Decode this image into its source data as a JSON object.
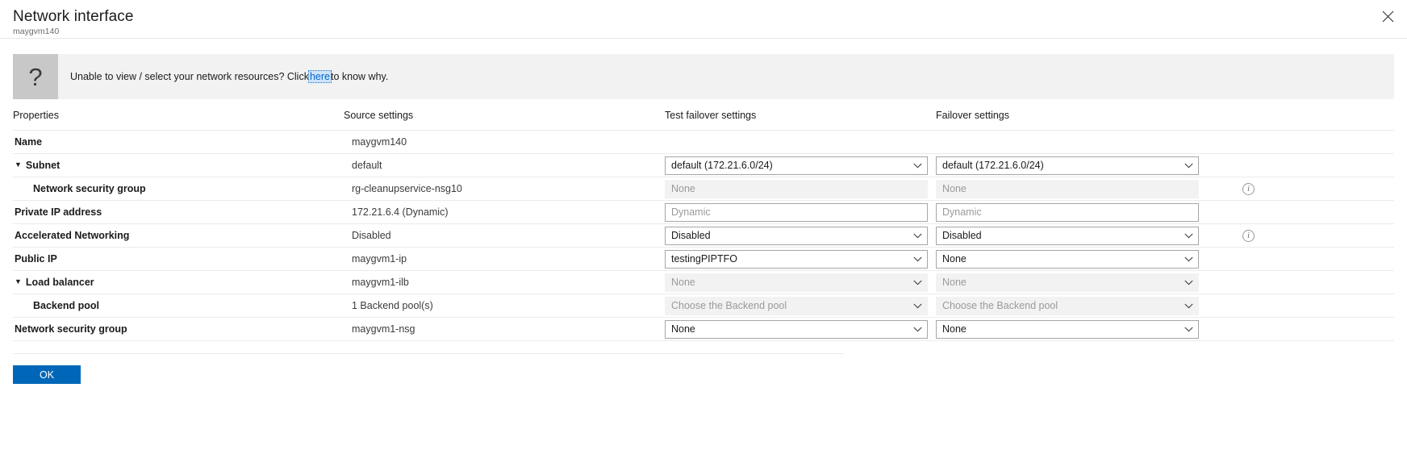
{
  "header": {
    "title": "Network interface",
    "subtitle": "maygvm140",
    "close_icon": "close-icon"
  },
  "banner": {
    "icon": "question-mark-icon",
    "icon_glyph": "?",
    "text_before": "Unable to view / select your network resources? Click ",
    "link_text": "here",
    "text_after": " to know why."
  },
  "table": {
    "headers": {
      "properties": "Properties",
      "source": "Source settings",
      "test_failover": "Test failover settings",
      "failover": "Failover settings"
    },
    "rows": [
      {
        "property": "Name",
        "expander": "",
        "indent": false,
        "source": "maygvm140",
        "tfo": {
          "type": "none"
        },
        "fo": {
          "type": "none"
        },
        "info": false
      },
      {
        "property": "Subnet",
        "expander": "▼",
        "indent": false,
        "source": "default",
        "tfo": {
          "type": "dropdown",
          "state": "enabled",
          "value": "default (172.21.6.0/24)"
        },
        "fo": {
          "type": "dropdown",
          "state": "enabled",
          "value": "default (172.21.6.0/24)"
        },
        "info": false
      },
      {
        "property": "Network security group",
        "expander": "",
        "indent": true,
        "source": "rg-cleanupservice-nsg10",
        "tfo": {
          "type": "plain",
          "state": "disabled",
          "value": "None"
        },
        "fo": {
          "type": "plain",
          "state": "disabled",
          "value": "None"
        },
        "info": true
      },
      {
        "property": "Private IP address",
        "expander": "",
        "indent": false,
        "source": "172.21.6.4 (Dynamic)",
        "tfo": {
          "type": "textbox",
          "state": "placeholder",
          "value": "Dynamic"
        },
        "fo": {
          "type": "textbox",
          "state": "placeholder",
          "value": "Dynamic"
        },
        "info": false
      },
      {
        "property": "Accelerated Networking",
        "expander": "",
        "indent": false,
        "source": "Disabled",
        "tfo": {
          "type": "dropdown",
          "state": "enabled",
          "value": "Disabled"
        },
        "fo": {
          "type": "dropdown",
          "state": "enabled",
          "value": "Disabled"
        },
        "info": true
      },
      {
        "property": "Public IP",
        "expander": "",
        "indent": false,
        "source": "maygvm1-ip",
        "tfo": {
          "type": "dropdown",
          "state": "enabled",
          "value": "testingPIPTFO"
        },
        "fo": {
          "type": "dropdown",
          "state": "enabled",
          "value": "None"
        },
        "info": false
      },
      {
        "property": "Load balancer",
        "expander": "▼",
        "indent": false,
        "source": "maygvm1-ilb",
        "tfo": {
          "type": "dropdown",
          "state": "disabled",
          "value": "None"
        },
        "fo": {
          "type": "dropdown",
          "state": "disabled",
          "value": "None"
        },
        "info": false
      },
      {
        "property": "Backend pool",
        "expander": "",
        "indent": true,
        "source": "1 Backend pool(s)",
        "tfo": {
          "type": "dropdown",
          "state": "disabled",
          "value": "Choose the Backend pool"
        },
        "fo": {
          "type": "dropdown",
          "state": "disabled",
          "value": "Choose the Backend pool"
        },
        "info": false
      },
      {
        "property": "Network security group",
        "expander": "",
        "indent": false,
        "source": "maygvm1-nsg",
        "tfo": {
          "type": "dropdown",
          "state": "enabled",
          "value": "None"
        },
        "fo": {
          "type": "dropdown",
          "state": "enabled",
          "value": "None"
        },
        "info": false
      }
    ]
  },
  "footer": {
    "ok_label": "OK"
  },
  "colors": {
    "accent": "#0067b8",
    "link": "#0066cc",
    "banner_bg": "#f2f2f2",
    "banner_icon_bg": "#c8c8c8",
    "disabled_text": "#9a9a9a",
    "border": "#a6a6a6",
    "row_rule": "#ebebeb"
  }
}
